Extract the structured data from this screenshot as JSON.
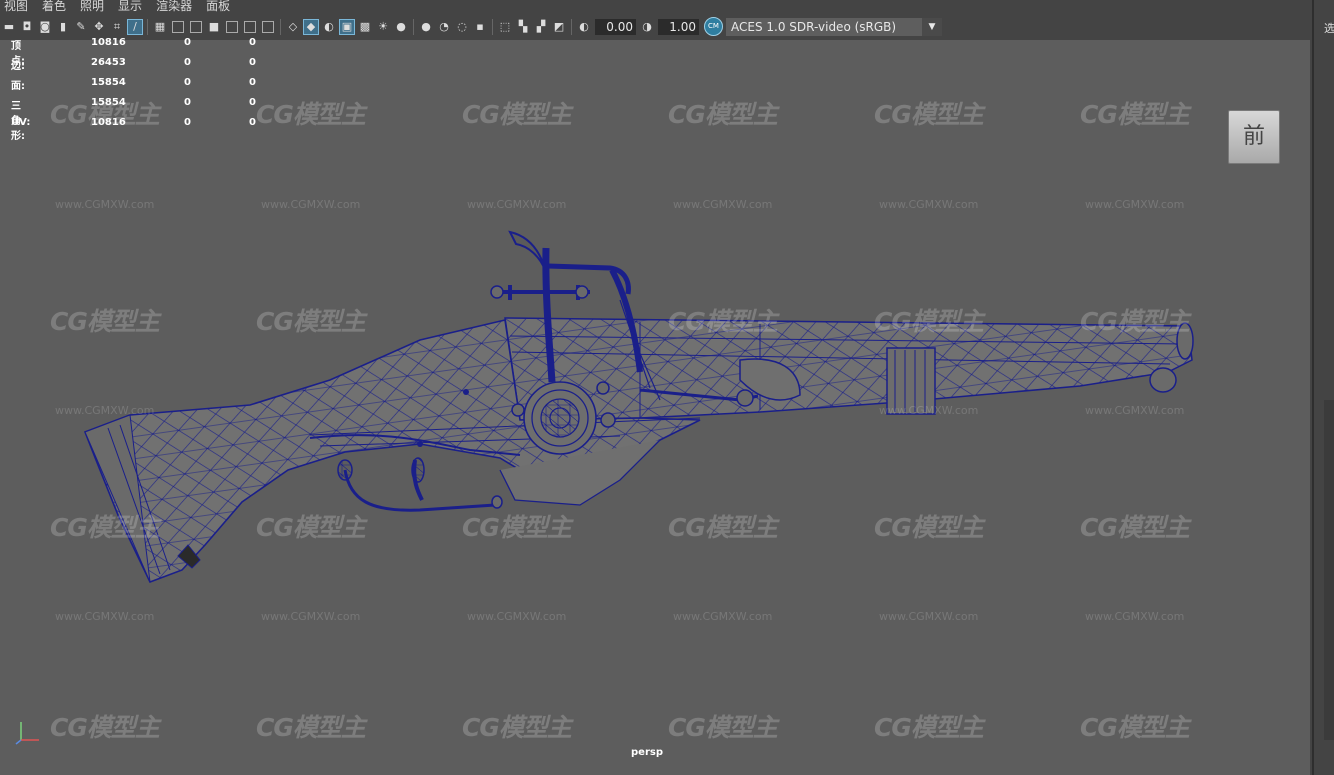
{
  "menubar": {
    "items": [
      "视图",
      "着色",
      "照明",
      "显示",
      "渲染器",
      "面板"
    ]
  },
  "toolbar": {
    "exposure": "0.00",
    "gamma": "1.00",
    "colorspace_badge": "CM",
    "view_transform": "ACES 1.0 SDR-video (sRGB)"
  },
  "hud": {
    "rows": [
      {
        "label": "顶点:",
        "values": [
          "10816",
          "0",
          "0"
        ]
      },
      {
        "label": "边:",
        "values": [
          "26453",
          "0",
          "0"
        ]
      },
      {
        "label": "面:",
        "values": [
          "15854",
          "0",
          "0"
        ]
      },
      {
        "label": "三角形:",
        "values": [
          "15854",
          "0",
          "0"
        ]
      },
      {
        "label": "UV:",
        "values": [
          "10816",
          "0",
          "0"
        ]
      }
    ]
  },
  "viewcube": {
    "face": "前"
  },
  "camera": "persp",
  "side_panel_text": "选",
  "watermark": {
    "logo": "CG模型主",
    "url": "www.CGMXW.com"
  },
  "colors": {
    "wire": "#1a1f8a",
    "mesh_fill": "#717171",
    "viewport_bg": "#5d5d5d",
    "toolbar_bg": "#444444"
  }
}
